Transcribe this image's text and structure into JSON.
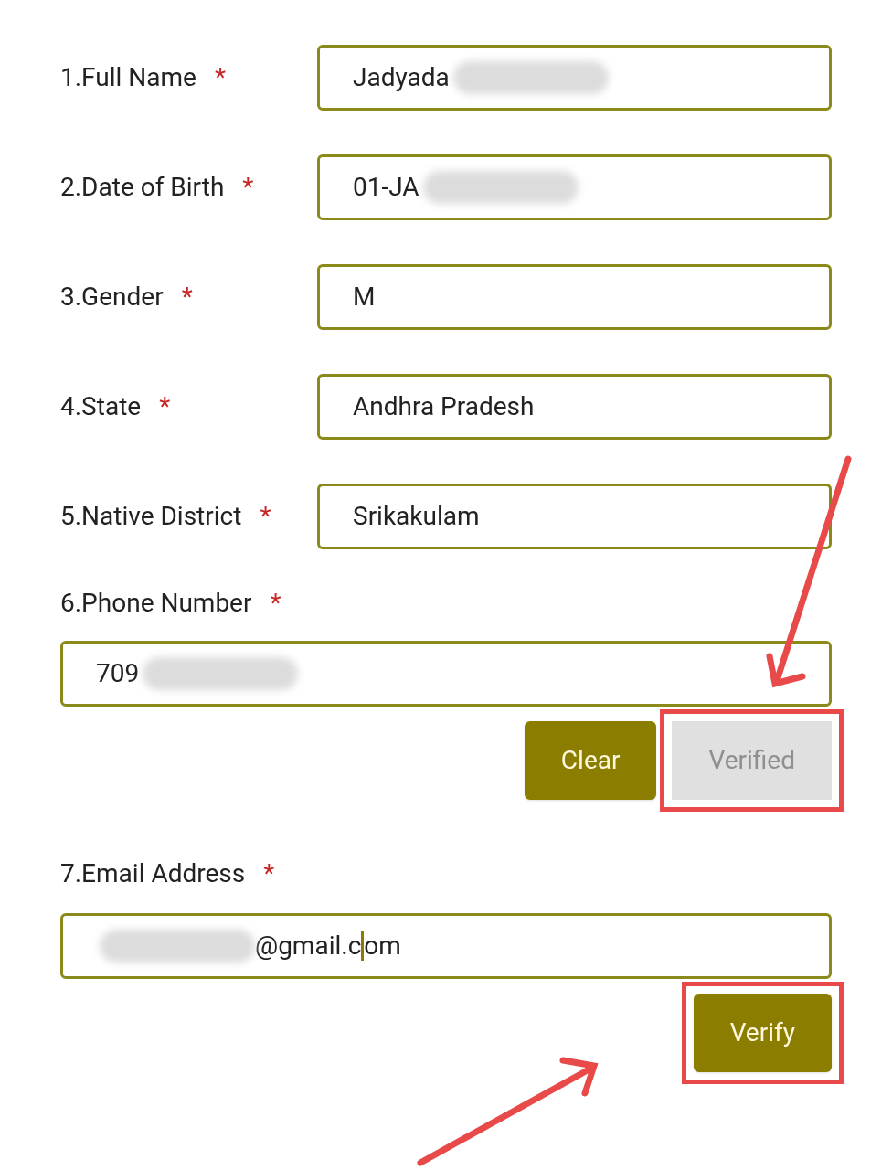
{
  "fields": [
    {
      "kind": "inline",
      "label": "1.Full Name",
      "required": "*",
      "value": "Jadyada",
      "redacted": true
    },
    {
      "kind": "inline",
      "label": "2.Date of Birth",
      "required": "*",
      "value": "01-JA",
      "redacted": true
    },
    {
      "kind": "inline",
      "label": "3.Gender",
      "required": "*",
      "value": "M",
      "redacted": false
    },
    {
      "kind": "inline",
      "label": "4.State",
      "required": "*",
      "value": "Andhra Pradesh",
      "redacted": false
    },
    {
      "kind": "inline",
      "label": "5.Native District",
      "required": "*",
      "value": "Srikakulam",
      "redacted": false
    },
    {
      "kind": "stacked",
      "label": "6.Phone Number",
      "required": "*",
      "value": "709",
      "redacted": true,
      "buttons": [
        {
          "label": "Clear",
          "disabled": false,
          "highlighted": false
        },
        {
          "label": "Verified",
          "disabled": true,
          "highlighted": true
        }
      ]
    },
    {
      "kind": "email",
      "label": "7.Email Address",
      "required": "*",
      "value_before_cursor": "@gmail.c",
      "value_after_cursor": "om",
      "redacted": true,
      "buttons": [
        {
          "label": "Verify",
          "disabled": false,
          "highlighted": true
        }
      ]
    }
  ]
}
